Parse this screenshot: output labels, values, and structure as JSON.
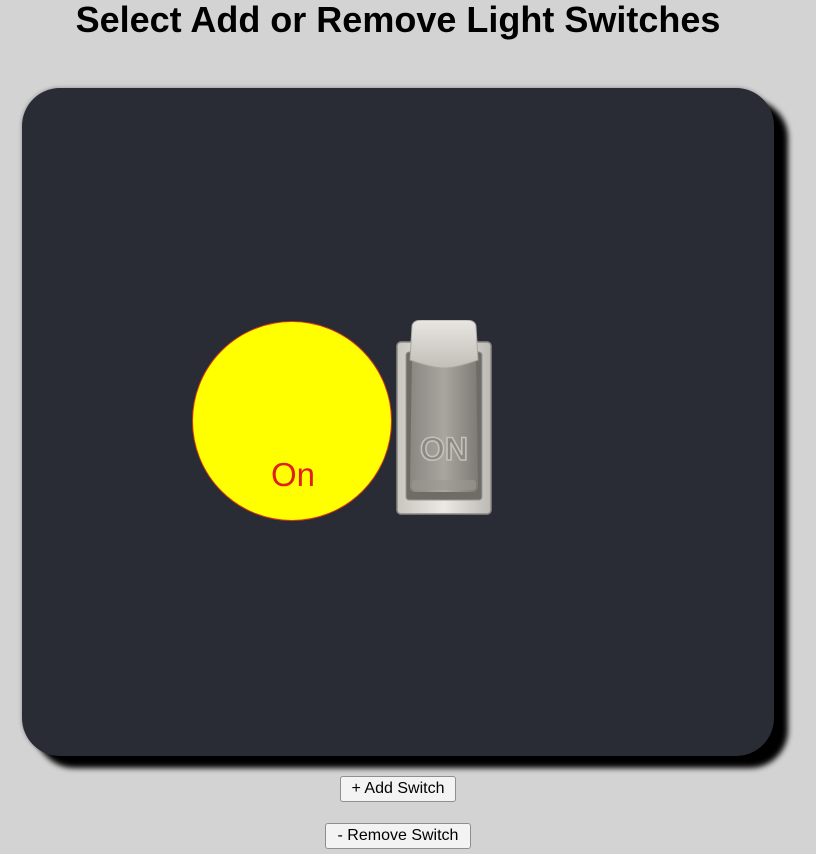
{
  "page": {
    "title": "Select Add or Remove Light Switches"
  },
  "light": {
    "state_label": "On",
    "is_on": true,
    "colors": {
      "bulb_fill": "#ffff00",
      "label": "#e0201b",
      "panel": "#292c34",
      "background": "#d3d3d3"
    }
  },
  "switch": {
    "embossed_text": "ON",
    "icon": "toggle-switch-icon"
  },
  "controls": {
    "add_label": "+ Add Switch",
    "remove_label": "- Remove Switch"
  }
}
